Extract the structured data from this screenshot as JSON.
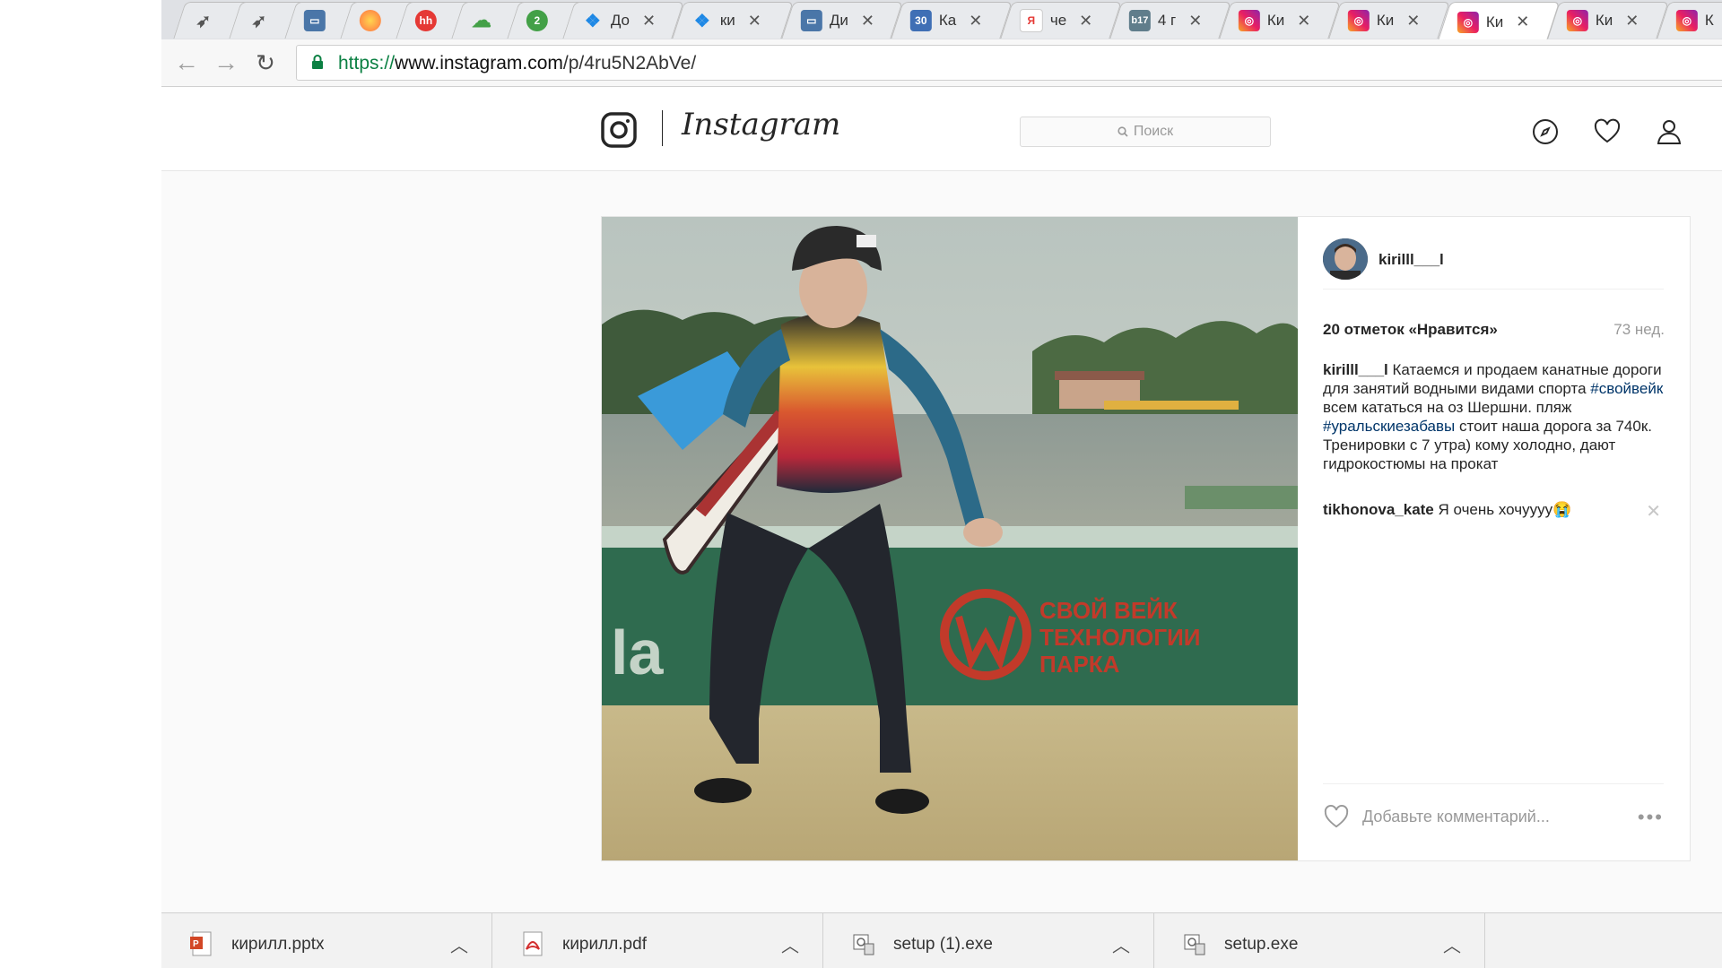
{
  "browser": {
    "tabs": [
      {
        "icon": "rocket-icon",
        "label": ""
      },
      {
        "icon": "rocket-icon",
        "label": ""
      },
      {
        "icon": "chat-icon",
        "label": ""
      },
      {
        "icon": "chrome-ball-icon",
        "label": ""
      },
      {
        "icon": "hh-icon",
        "label": "hh"
      },
      {
        "icon": "cloud-icon",
        "label": ""
      },
      {
        "icon": "circle-2-icon",
        "label": "2"
      },
      {
        "icon": "dropbox-icon",
        "label": "До"
      },
      {
        "icon": "dropbox-icon",
        "label": "ки"
      },
      {
        "icon": "chat-icon",
        "label": "Ди"
      },
      {
        "icon": "calendar-30-icon",
        "label": "Ка"
      },
      {
        "icon": "yandex-icon",
        "label": "че"
      },
      {
        "icon": "b17-icon",
        "label": "4 г"
      },
      {
        "icon": "instagram-icon",
        "label": "Ки"
      },
      {
        "icon": "instagram-icon",
        "label": "Ки"
      },
      {
        "icon": "instagram-icon",
        "label": "Ки"
      },
      {
        "icon": "instagram-icon",
        "label": "Ки"
      },
      {
        "icon": "instagram-icon",
        "label": "К"
      }
    ],
    "active_tab": 14,
    "url_scheme": "https://",
    "url_host": "www.instagram.com",
    "url_path": "/p/4ru5N2AbVe/"
  },
  "header": {
    "wordmark": "Instagram",
    "search_placeholder": "Поиск"
  },
  "post": {
    "author": "kirilll___l",
    "likes": "20 отметок «Нравится»",
    "age": "73 нед.",
    "caption": {
      "user": "kirilll___l",
      "text1": " Катаемся и продаем канатные дороги для занятий водными видами спорта ",
      "tag1": "#свойвейк",
      "text2": " всем кататься на оз Шершни. пляж ",
      "tag2": "#уральскиезабавы",
      "text3": " стоит наша дорога за 740к. Тренировки с 7 утра) кому холодно, дают гидрокостюмы на прокат"
    },
    "comment": {
      "user": "tikhonova_kate",
      "text": " Я очень хочуууу😭"
    },
    "add_comment_placeholder": "Добавьте комментарий...",
    "more_label": "•••"
  },
  "downloads": [
    {
      "name": "кирилл.pptx",
      "icon": "powerpoint-file-icon"
    },
    {
      "name": "кирилл.pdf",
      "icon": "pdf-file-icon"
    },
    {
      "name": "setup (1).exe",
      "icon": "installer-file-icon"
    },
    {
      "name": "setup.exe",
      "icon": "installer-file-icon"
    }
  ],
  "colors": {
    "link": "#003569",
    "pdf_red": "#d32f2f",
    "ppt_orange": "#d24726"
  }
}
